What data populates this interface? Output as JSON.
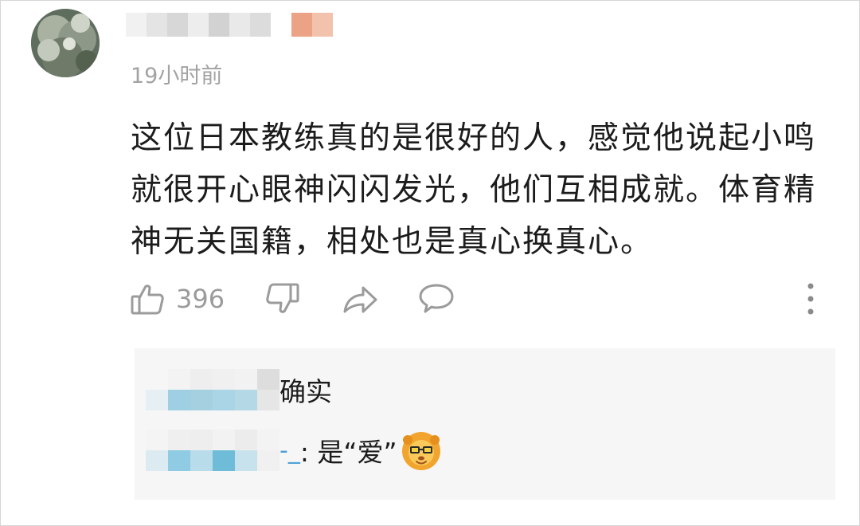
{
  "comment": {
    "timestamp": "19小时前",
    "text": "这位日本教练真的是很好的人，感觉他说起小鸣就很开心眼神闪闪发光，他们互相成就。体育精神无关国籍，相处也是真心换真心。",
    "like_count": "396",
    "icons": [
      "thumbs-up-icon",
      "thumbs-down-icon",
      "share-icon",
      "comment-icon",
      "more-vertical-icon"
    ]
  },
  "replies": [
    {
      "text": "确实"
    },
    {
      "separator": "-_",
      "text": ": 是“爱”",
      "sticker": "lion-sticker-icon"
    }
  ],
  "colors": {
    "accent": "#4ea1d8",
    "muted": "#a3a3a3",
    "reply_bg": "#f6f6f6"
  }
}
